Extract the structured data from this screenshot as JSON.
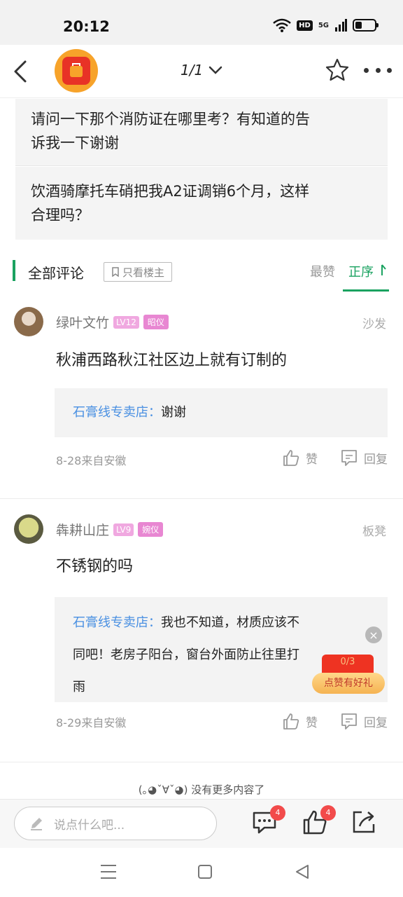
{
  "status": {
    "time": "20:12",
    "network": "5G",
    "hd": "HD"
  },
  "topnav": {
    "page": "1/1"
  },
  "quotes": [
    {
      "line1": "请问一下那个消防证在哪里考？有知道的告",
      "line2": "诉我一下谢谢"
    },
    {
      "line1": "饮酒骑摩托车硝把我A2证调销6个月，这样",
      "line2": "合理吗？"
    }
  ],
  "comments_header": {
    "title": "全部评论",
    "op_only": "只看楼主",
    "sort_hot": "最赞",
    "sort_asc": "正序"
  },
  "comments": [
    {
      "name": "绿叶文竹",
      "level": "LV12",
      "title": "昭仪",
      "floor": "沙发",
      "text": "秋浦西路秋江社区边上就有订制的",
      "reply_author": "石膏线专卖店：",
      "reply_text": "谢谢",
      "meta": "8-28来自安徽",
      "like": "赞",
      "reply": "回复"
    },
    {
      "name": "犇耕山庄",
      "level": "LV9",
      "title": "婉仪",
      "floor": "板凳",
      "text": "不锈钢的吗",
      "reply_author": "石膏线专卖店：",
      "reply_line1": "我也不知道，材质应该不",
      "reply_line2": "同吧！老房子阳台，窗台外面防止往里打",
      "reply_line3": "雨",
      "meta": "8-29来自安徽",
      "like": "赞",
      "reply": "回复"
    }
  ],
  "promo": {
    "counter": "0/3",
    "button": "点赞有好礼"
  },
  "end_text": "(｡◕ˇ∀ˇ◕) 没有更多内容了",
  "bottom_bar": {
    "placeholder": "说点什么吧...",
    "comment_count": "4",
    "like_count": "4"
  },
  "colors": {
    "accent": "#1aa260",
    "link": "#4a90e2",
    "badge": "#f24b4b"
  }
}
